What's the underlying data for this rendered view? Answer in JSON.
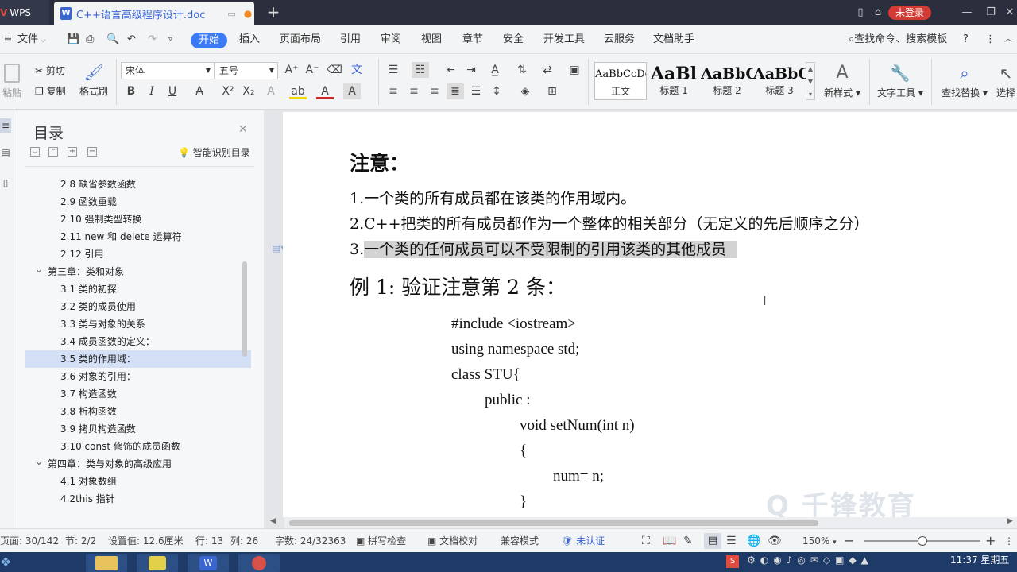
{
  "titlebar": {
    "app_name": "WPS",
    "doc_tab_title": "C++语言高级程序设计.doc",
    "login_label": "未登录"
  },
  "menu": {
    "file_label": "文件",
    "items": [
      "开始",
      "插入",
      "页面布局",
      "引用",
      "审阅",
      "视图",
      "章节",
      "安全",
      "开发工具",
      "云服务",
      "文档助手"
    ],
    "search_label": "查找命令、搜索模板"
  },
  "ribbon": {
    "paste_label": "粘贴",
    "cut_label": "剪切",
    "copy_label": "复制",
    "format_painter_label": "格式刷",
    "font_name": "宋体",
    "font_size": "五号",
    "styles": [
      {
        "sample": "AaBbCcDd",
        "name": "正文"
      },
      {
        "sample": "AaBl",
        "name": "标题 1"
      },
      {
        "sample": "AaBbC",
        "name": "标题 2"
      },
      {
        "sample": "AaBbC",
        "name": "标题 3"
      }
    ],
    "new_style_label": "新样式",
    "text_tools_label": "文字工具",
    "find_replace_label": "查找替换",
    "select_label": "选择"
  },
  "toc": {
    "title": "目录",
    "smart_label": "智能识别目录",
    "items": [
      {
        "text": "2.8  缺省参数函数",
        "level": 2,
        "selected": false
      },
      {
        "text": "2.9  函数重载",
        "level": 2,
        "selected": false
      },
      {
        "text": "2.10  强制类型转换",
        "level": 2,
        "selected": false
      },
      {
        "text": "2.11  new 和 delete 运算符",
        "level": 2,
        "selected": false
      },
      {
        "text": "2.12  引用",
        "level": 2,
        "selected": false
      },
      {
        "text": "第三章：类和对象",
        "level": 1,
        "selected": false
      },
      {
        "text": "3.1 类的初探",
        "level": 2,
        "selected": false
      },
      {
        "text": "3.2 类的成员使用",
        "level": 2,
        "selected": false
      },
      {
        "text": "3.3 类与对象的关系",
        "level": 2,
        "selected": false
      },
      {
        "text": "3.4 成员函数的定义：",
        "level": 2,
        "selected": false
      },
      {
        "text": "3.5 类的作用域：",
        "level": 2,
        "selected": true
      },
      {
        "text": "3.6 对象的引用：",
        "level": 2,
        "selected": false
      },
      {
        "text": "3.7 构造函数",
        "level": 2,
        "selected": false
      },
      {
        "text": "3.8 析构函数",
        "level": 2,
        "selected": false
      },
      {
        "text": "3.9 拷贝构造函数",
        "level": 2,
        "selected": false
      },
      {
        "text": "3.10 const  修饰的成员函数",
        "level": 2,
        "selected": false
      },
      {
        "text": "第四章：类与对象的高级应用",
        "level": 1,
        "selected": false
      },
      {
        "text": "4.1 对象数组",
        "level": 2,
        "selected": false
      },
      {
        "text": "4.2this 指针",
        "level": 2,
        "selected": false
      }
    ]
  },
  "document": {
    "heading": "注意：",
    "notes": [
      "1.一个类的所有成员都在该类的作用域内。",
      "2.C++把类的所有成员都作为一个整体的相关部分（无定义的先后顺序之分）",
      "3.",
      "一个类的任何成员可以不受限制的引用该类的其他成员"
    ],
    "example_title": "例 1:  验证注意第 2 条：",
    "code_lines": [
      "#include <iostream>",
      "using namespace std;",
      "class STU{",
      "public :",
      "void setNum(int n)",
      "{",
      "num=    n;",
      "}"
    ],
    "watermark": "千锋教育"
  },
  "status": {
    "page": "页面: 30/142",
    "section": "节: 2/2",
    "position": "设置值: 12.6厘米",
    "row": "行: 13",
    "col": "列: 26",
    "word_count": "字数: 24/32363",
    "spell_check": "拼写检查",
    "doc_proof": "文档校对",
    "compat_mode": "兼容模式",
    "cert": "未认证",
    "zoom": "150% ",
    "zoom_fraction": 0.5
  },
  "taskbar": {
    "clock_time": "11:37 星期五"
  },
  "colors": {
    "accent": "#3d7af6",
    "titlebar": "#2b2f3d",
    "login": "#d33c35",
    "selected_toc": "#d3e0f6",
    "highlight": "#d3d3d3"
  }
}
